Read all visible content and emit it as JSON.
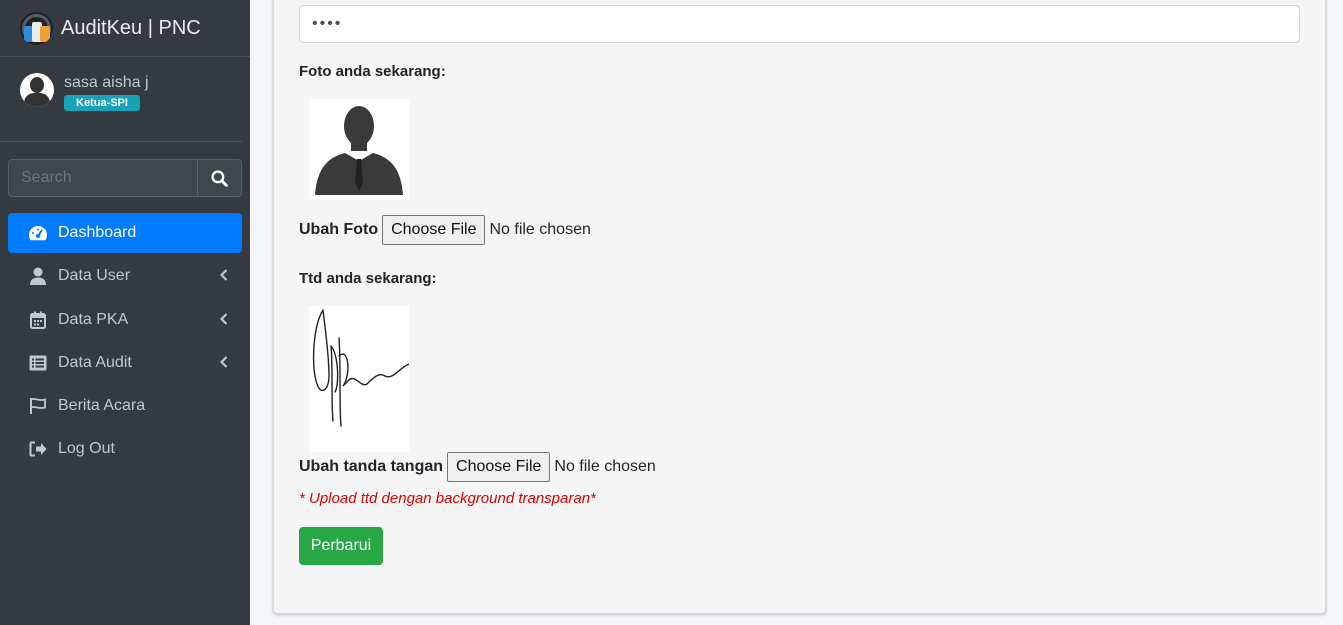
{
  "app": {
    "title": "AuditKeu | PNC"
  },
  "user": {
    "name": "sasa aisha j",
    "role": "Ketua-SPI"
  },
  "search": {
    "placeholder": "Search"
  },
  "nav": [
    {
      "label": "Dashboard",
      "icon": "dashboard-icon",
      "active": true
    },
    {
      "label": "Data User",
      "icon": "user-icon",
      "has_children": true
    },
    {
      "label": "Data PKA",
      "icon": "calendar-icon",
      "has_children": true
    },
    {
      "label": "Data Audit",
      "icon": "list-icon",
      "has_children": true
    },
    {
      "label": "Berita Acara",
      "icon": "flag-icon"
    },
    {
      "label": "Log Out",
      "icon": "logout-icon"
    }
  ],
  "form": {
    "password_value": "••••",
    "photo_label": "Foto anda sekarang:",
    "change_photo_label": "Ubah Foto",
    "signature_label": "Ttd anda sekarang:",
    "change_signature_label": "Ubah tanda tangan",
    "choose_file": "Choose File",
    "no_file": "No file chosen",
    "note": "* Upload ttd dengan background transparan*",
    "submit": "Perbarui"
  },
  "colors": {
    "sidebar": "#343a40",
    "primary": "#007bff",
    "success": "#28a745",
    "info": "#17a2b8",
    "danger": "#dc0000"
  }
}
